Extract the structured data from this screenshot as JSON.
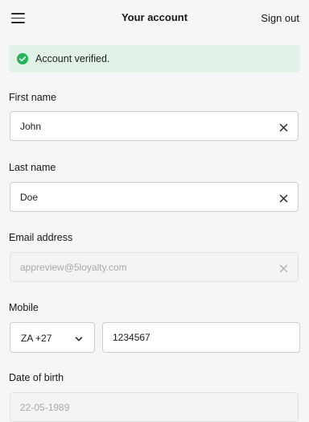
{
  "header": {
    "menu_icon": "hamburger-menu-icon",
    "title": "Your account",
    "signout_label": "Sign out"
  },
  "banner": {
    "icon": "check-circle-icon",
    "message": "Account verified.",
    "color": "#23b45a",
    "background": "#e1f3e7"
  },
  "form": {
    "first_name": {
      "label": "First name",
      "value": "John"
    },
    "last_name": {
      "label": "Last name",
      "value": "Doe"
    },
    "email": {
      "label": "Email address",
      "value": "appreview@5loyalty.com",
      "disabled": true
    },
    "mobile": {
      "label": "Mobile",
      "country_code": "ZA +27",
      "number": "1234567"
    },
    "dob": {
      "label": "Date of birth",
      "value": "22-05-1989",
      "disabled": true
    }
  }
}
